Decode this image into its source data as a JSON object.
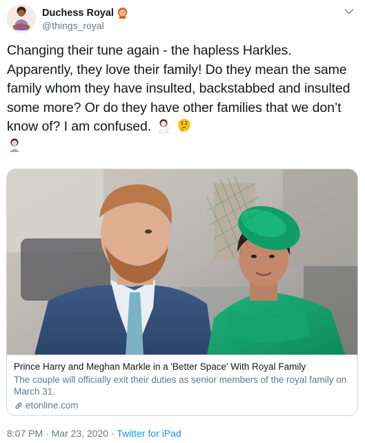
{
  "author": {
    "display_name": "Duchess Royal",
    "handle": "@things_royal",
    "avatar_icon": "meditating-woman-avatar-icon",
    "name_emoji_icon": "red-haired-woman-emoji-icon"
  },
  "tweet": {
    "text": "Changing their tune again - the hapless Harkles. Apparently, they love their family! Do they mean the same family whom they have insulted, backstabbed and insulted some more? Or do they have other families that we don’t know of? I am confused.",
    "emojis": [
      "woman-tipping-hand-icon",
      "thinking-face-icon",
      "woman-facepalming-icon"
    ]
  },
  "card": {
    "title": "Prince Harry and Meghan Markle in a 'Better Space' With Royal Family",
    "description": "The couple will officially exit their duties as senior members of the royal family on March 31.",
    "domain": "etonline.com",
    "link_icon": "link-icon"
  },
  "meta": {
    "time": "8:07 PM",
    "separator": "·",
    "date": "Mar 23, 2020",
    "source": "Twitter for iPad"
  },
  "colors": {
    "text": "#14171a",
    "secondary": "#657786",
    "link": "#1b95e0",
    "border": "#ccd6dd"
  }
}
